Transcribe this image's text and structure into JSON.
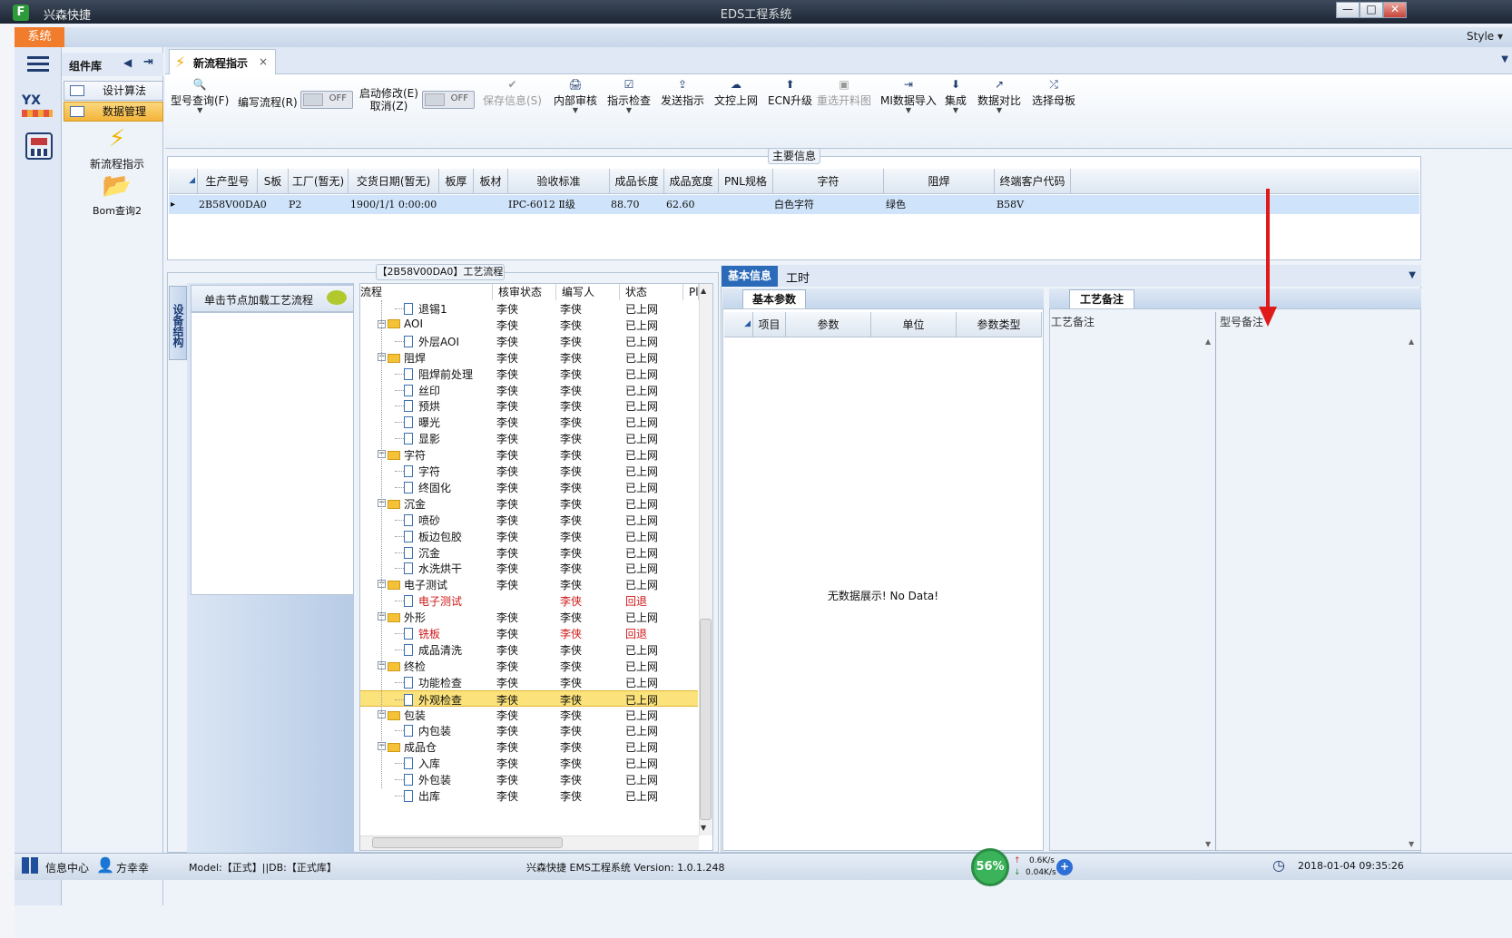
{
  "window": {
    "app_name": "兴森快捷",
    "title": "EDS工程系统",
    "logo_letter": "F",
    "min": "—",
    "max": "□",
    "close": "✕"
  },
  "menu": {
    "system": "系统",
    "style": "Style ▾"
  },
  "components": {
    "title": "组件库",
    "items": [
      {
        "label": "设计算法"
      },
      {
        "label": "数据管理"
      }
    ],
    "quick": [
      {
        "label": "新流程指示",
        "icon": "⚡"
      },
      {
        "label": "Bom查询2",
        "icon": "📂"
      }
    ],
    "ico_yx": "YX"
  },
  "doc_tab": {
    "label": "新流程指示",
    "close": "×"
  },
  "toolbar": {
    "buttons": [
      {
        "label": "型号查询(F)",
        "glyph": "🔍",
        "caret": true
      },
      {
        "label": "编写流程(R)"
      },
      {
        "label": "启动修改(E)",
        "sub": "取消(Z)"
      },
      {
        "label": "保存信息(S)",
        "glyph": "✔",
        "disabled": true
      },
      {
        "label": "内部审核",
        "glyph": "🖨",
        "caret": true
      },
      {
        "label": "指示检查",
        "glyph": "☑",
        "caret": true
      },
      {
        "label": "发送指示",
        "glyph": "⇪"
      },
      {
        "label": "文控上网",
        "glyph": "☁"
      },
      {
        "label": "ECN升级",
        "glyph": "⬆"
      },
      {
        "label": "重选开料图",
        "glyph": "▣",
        "disabled": true
      },
      {
        "label": "MI数据导入",
        "glyph": "⇥",
        "caret": true
      },
      {
        "label": "集成",
        "glyph": "⬇",
        "caret": true
      },
      {
        "label": "数据对比",
        "glyph": "↗",
        "caret": true
      },
      {
        "label": "选择母板",
        "glyph": "⤮"
      }
    ],
    "toggle1": "OFF",
    "toggle2": "OFF"
  },
  "main_info": {
    "caption": "主要信息",
    "columns": [
      "生产型号",
      "S板",
      "工厂(暂无)",
      "交货日期(暂无)",
      "板厚",
      "板材",
      "验收标准",
      "成品长度",
      "成品宽度",
      "PNL规格",
      "字符",
      "阻焊",
      "终端客户代码"
    ],
    "row": [
      "2B58V00DA0",
      "",
      "P2",
      "1900/1/1 0:00:00",
      "",
      "",
      "IPC-6012 Ⅱ级",
      "88.70",
      "62.60",
      "",
      "白色字符",
      "绿色",
      "B58V"
    ],
    "row_marker": "▸"
  },
  "flow": {
    "caption": "【2B58V00DA0】工艺流程",
    "side_tab": "设备结构",
    "node_hint": "单击节点加载工艺流程",
    "columns": [
      "流程",
      "核审状态",
      "编写人",
      "状态",
      "Pl"
    ],
    "rows": [
      {
        "name": "退锡1",
        "level": 2,
        "audit": "李侠",
        "writer": "李侠",
        "status": "已上网"
      },
      {
        "name": "AOI",
        "level": 1,
        "audit": "李侠",
        "writer": "李侠",
        "status": "已上网"
      },
      {
        "name": "外层AOI",
        "level": 2,
        "audit": "李侠",
        "writer": "李侠",
        "status": "已上网"
      },
      {
        "name": "阻焊",
        "level": 1,
        "audit": "李侠",
        "writer": "李侠",
        "status": "已上网"
      },
      {
        "name": "阻焊前处理",
        "level": 2,
        "audit": "李侠",
        "writer": "李侠",
        "status": "已上网"
      },
      {
        "name": "丝印",
        "level": 2,
        "audit": "李侠",
        "writer": "李侠",
        "status": "已上网"
      },
      {
        "name": "预烘",
        "level": 2,
        "audit": "李侠",
        "writer": "李侠",
        "status": "已上网"
      },
      {
        "name": "曝光",
        "level": 2,
        "audit": "李侠",
        "writer": "李侠",
        "status": "已上网"
      },
      {
        "name": "显影",
        "level": 2,
        "audit": "李侠",
        "writer": "李侠",
        "status": "已上网"
      },
      {
        "name": "字符",
        "level": 1,
        "audit": "李侠",
        "writer": "李侠",
        "status": "已上网"
      },
      {
        "name": "字符",
        "level": 2,
        "audit": "李侠",
        "writer": "李侠",
        "status": "已上网"
      },
      {
        "name": "终固化",
        "level": 2,
        "audit": "李侠",
        "writer": "李侠",
        "status": "已上网"
      },
      {
        "name": "沉金",
        "level": 1,
        "audit": "李侠",
        "writer": "李侠",
        "status": "已上网"
      },
      {
        "name": "喷砂",
        "level": 2,
        "audit": "李侠",
        "writer": "李侠",
        "status": "已上网"
      },
      {
        "name": "板边包胶",
        "level": 2,
        "audit": "李侠",
        "writer": "李侠",
        "status": "已上网"
      },
      {
        "name": "沉金",
        "level": 2,
        "audit": "李侠",
        "writer": "李侠",
        "status": "已上网"
      },
      {
        "name": "水洗烘干",
        "level": 2,
        "audit": "李侠",
        "writer": "李侠",
        "status": "已上网"
      },
      {
        "name": "电子测试",
        "level": 1,
        "audit": "李侠",
        "writer": "李侠",
        "status": "已上网"
      },
      {
        "name": "电子测试",
        "level": 2,
        "audit": "",
        "writer": "李侠",
        "status": "回退",
        "red": true
      },
      {
        "name": "外形",
        "level": 1,
        "audit": "李侠",
        "writer": "李侠",
        "status": "已上网"
      },
      {
        "name": "铣板",
        "level": 2,
        "audit": "李侠",
        "writer": "李侠",
        "status": "回退",
        "red": true
      },
      {
        "name": "成品清洗",
        "level": 2,
        "audit": "李侠",
        "writer": "李侠",
        "status": "已上网"
      },
      {
        "name": "终检",
        "level": 1,
        "audit": "李侠",
        "writer": "李侠",
        "status": "已上网"
      },
      {
        "name": "功能检查",
        "level": 2,
        "audit": "李侠",
        "writer": "李侠",
        "status": "已上网"
      },
      {
        "name": "外观检查",
        "level": 2,
        "audit": "李侠",
        "writer": "李侠",
        "status": "已上网",
        "selected": true
      },
      {
        "name": "包装",
        "level": 1,
        "audit": "李侠",
        "writer": "李侠",
        "status": "已上网"
      },
      {
        "name": "内包装",
        "level": 2,
        "audit": "李侠",
        "writer": "李侠",
        "status": "已上网"
      },
      {
        "name": "成品仓",
        "level": 1,
        "audit": "李侠",
        "writer": "李侠",
        "status": "已上网"
      },
      {
        "name": "入库",
        "level": 2,
        "audit": "李侠",
        "writer": "李侠",
        "status": "已上网"
      },
      {
        "name": "外包装",
        "level": 2,
        "audit": "李侠",
        "writer": "李侠",
        "status": "已上网"
      },
      {
        "name": "出库",
        "level": 2,
        "audit": "李侠",
        "writer": "李侠",
        "status": "已上网"
      }
    ]
  },
  "detail": {
    "tabs": [
      "基本信息",
      "工时"
    ],
    "basic_params": {
      "tab": "基本参数",
      "columns": [
        "项目",
        "参数",
        "单位",
        "参数类型"
      ],
      "empty": "无数据展示! No Data!"
    },
    "memo": {
      "tab": "工艺备注",
      "col1": "工艺备注",
      "col2": "型号备注"
    }
  },
  "status": {
    "info_center": "信息中心",
    "user": "方幸幸",
    "model": "Model:【正式】||DB:【正式库】",
    "version": "兴森快捷 EMS工程系统 Version: 1.0.1.248",
    "net_percent": "56%",
    "up": "0.6K/s",
    "down": "0.04K/s",
    "datetime": "2018-01-04 09:35:26"
  }
}
